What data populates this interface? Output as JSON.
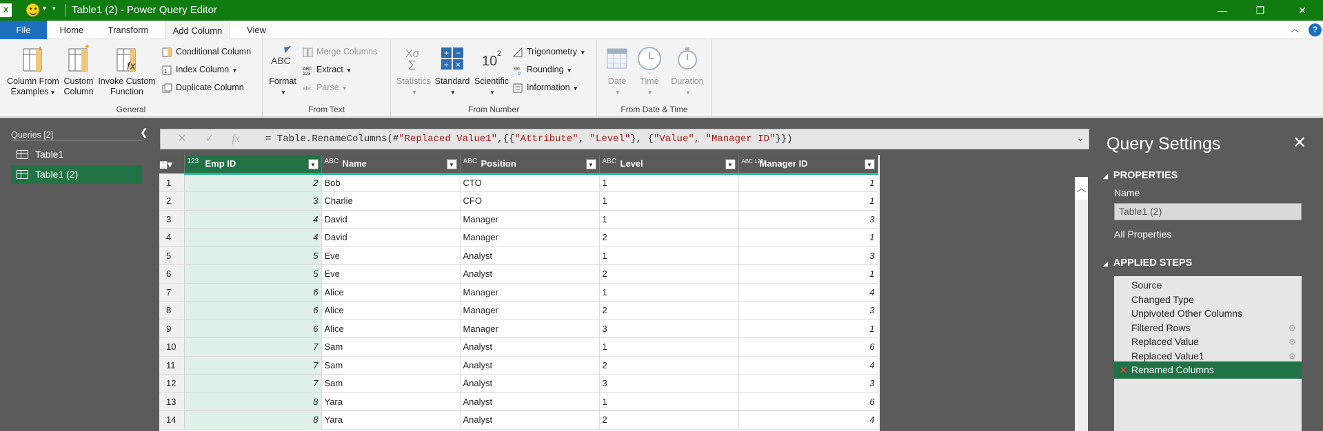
{
  "window": {
    "title": "Table1 (2) - Power Query Editor",
    "app_icon": "X",
    "controls": [
      "minimize-icon",
      "restore-icon",
      "close-icon"
    ]
  },
  "menu": {
    "file": "File",
    "tabs": [
      "Home",
      "Transform",
      "Add Column",
      "View"
    ],
    "active_tab": "Add Column",
    "help": "?"
  },
  "ribbon": {
    "general": {
      "label": "General",
      "column_from_examples": [
        "Column From",
        "Examples"
      ],
      "custom_column": [
        "Custom",
        "Column"
      ],
      "invoke_custom_function": [
        "Invoke Custom",
        "Function"
      ],
      "conditional_column": "Conditional Column",
      "index_column": "Index Column",
      "duplicate_column": "Duplicate Column"
    },
    "from_text": {
      "label": "From Text",
      "format": "Format",
      "merge_columns": "Merge Columns",
      "extract": "Extract",
      "parse": "Parse"
    },
    "from_number": {
      "label": "From Number",
      "statistics": "Statistics",
      "standard": "Standard",
      "scientific": "Scientific",
      "trigonometry": "Trigonometry",
      "rounding": "Rounding",
      "information": "Information"
    },
    "from_date_time": {
      "label": "From Date & Time",
      "date": "Date",
      "time": "Time",
      "duration": "Duration"
    }
  },
  "queries": {
    "header": "Queries [2]",
    "items": [
      "Table1",
      "Table1 (2)"
    ],
    "selected": "Table1 (2)"
  },
  "formula_bar": {
    "fx": "fx",
    "formula_prefix": "= Table.RenameColumns(#",
    "s1": "\"Replaced Value1\"",
    "mid1": ",{{",
    "s2": "\"Attribute\"",
    "mid2": ", ",
    "s3": "\"Level\"",
    "mid3": "}, {",
    "s4": "\"Value\"",
    "mid4": ", ",
    "s5": "\"Manager ID\"",
    "suffix": "}})"
  },
  "table": {
    "columns": [
      {
        "type": "123",
        "name": "Emp ID"
      },
      {
        "type": "ABC",
        "name": "Name"
      },
      {
        "type": "ABC",
        "name": "Position"
      },
      {
        "type": "ABC",
        "name": "Level"
      },
      {
        "type": "ABC 123",
        "name": "Manager ID"
      }
    ],
    "rows": [
      [
        "1",
        "2",
        "Bob",
        "CTO",
        "1",
        "1"
      ],
      [
        "2",
        "3",
        "Charlie",
        "CFO",
        "1",
        "1"
      ],
      [
        "3",
        "4",
        "David",
        "Manager",
        "1",
        "3"
      ],
      [
        "4",
        "4",
        "David",
        "Manager",
        "2",
        "1"
      ],
      [
        "5",
        "5",
        "Eve",
        "Analyst",
        "1",
        "3"
      ],
      [
        "6",
        "5",
        "Eve",
        "Analyst",
        "2",
        "1"
      ],
      [
        "7",
        "6",
        "Alice",
        "Manager",
        "1",
        "4"
      ],
      [
        "8",
        "6",
        "Alice",
        "Manager",
        "2",
        "3"
      ],
      [
        "9",
        "6",
        "Alice",
        "Manager",
        "3",
        "1"
      ],
      [
        "10",
        "7",
        "Sam",
        "Analyst",
        "1",
        "6"
      ],
      [
        "11",
        "7",
        "Sam",
        "Analyst",
        "2",
        "4"
      ],
      [
        "12",
        "7",
        "Sam",
        "Analyst",
        "3",
        "3"
      ],
      [
        "13",
        "8",
        "Yara",
        "Analyst",
        "1",
        "6"
      ],
      [
        "14",
        "8",
        "Yara",
        "Analyst",
        "2",
        "4"
      ]
    ]
  },
  "query_settings": {
    "title": "Query Settings",
    "properties_header": "PROPERTIES",
    "name_label": "Name",
    "name_value": "Table1 (2)",
    "all_properties": "All Properties",
    "applied_steps_header": "APPLIED STEPS",
    "steps": [
      {
        "label": "Source",
        "gear": false
      },
      {
        "label": "Changed Type",
        "gear": false
      },
      {
        "label": "Unpivoted Other Columns",
        "gear": false
      },
      {
        "label": "Filtered Rows",
        "gear": true
      },
      {
        "label": "Replaced Value",
        "gear": true
      },
      {
        "label": "Replaced Value1",
        "gear": true
      },
      {
        "label": "Renamed Columns",
        "gear": false,
        "selected": true
      }
    ]
  },
  "colors": {
    "title_bar": "#107c10",
    "accent": "#217346",
    "file_tab": "#1c6fbf",
    "panel": "#5b5b5b"
  }
}
